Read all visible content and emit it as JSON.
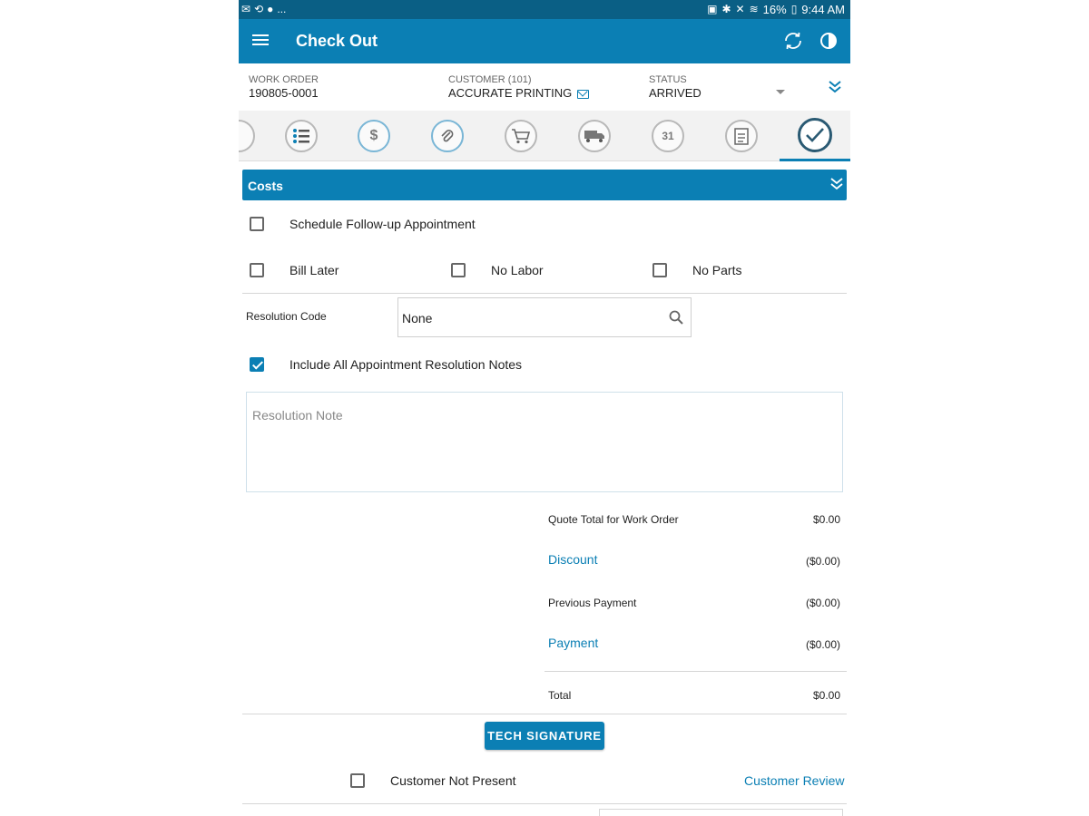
{
  "status_bar": {
    "overflow": "...",
    "battery": "16%",
    "time": "9:44 AM"
  },
  "app_bar": {
    "title": "Check Out"
  },
  "work_order_header": {
    "work_order_label": "WORK ORDER",
    "work_order_value": "190805-0001",
    "customer_label": "CUSTOMER (101)",
    "customer_value": "ACCURATE PRINTING",
    "status_label": "STATUS",
    "status_value": "ARRIVED"
  },
  "tabs": [
    {
      "icon": "partial-tab-icon"
    },
    {
      "icon": "list-icon"
    },
    {
      "icon": "dollar-quote-icon"
    },
    {
      "icon": "attachment-icon"
    },
    {
      "icon": "cart-icon"
    },
    {
      "icon": "truck-icon"
    },
    {
      "icon": "calendar-icon",
      "day": "31"
    },
    {
      "icon": "checklist-icon"
    },
    {
      "icon": "checkout-check-icon",
      "active": true
    }
  ],
  "costs_section": {
    "title": "Costs"
  },
  "options": {
    "schedule_follow_up": {
      "label": "Schedule Follow-up Appointment",
      "checked": false
    },
    "bill_later": {
      "label": "Bill Later",
      "checked": false
    },
    "no_labor": {
      "label": "No Labor",
      "checked": false
    },
    "no_parts": {
      "label": "No Parts",
      "checked": false
    },
    "include_notes": {
      "label": "Include All Appointment Resolution Notes",
      "checked": true
    }
  },
  "resolution": {
    "code_label": "Resolution Code",
    "code_value": "None",
    "note_placeholder": "Resolution Note"
  },
  "totals": {
    "quote_total_label": "Quote Total for Work Order",
    "quote_total_value": "$0.00",
    "discount_label": "Discount",
    "discount_value": "($0.00)",
    "previous_payment_label": "Previous Payment",
    "previous_payment_value": "($0.00)",
    "payment_label": "Payment",
    "payment_value": "($0.00)",
    "total_label": "Total",
    "total_value": "$0.00"
  },
  "signature": {
    "tech_signature_label": "TECH SIGNATURE",
    "customer_not_present_label": "Customer Not Present",
    "customer_not_present_checked": false,
    "customer_review_label": "Customer Review"
  },
  "colors": {
    "primary": "#0b7fb4",
    "status_bar": "#0a5f85",
    "active_tab_icon": "#2a5a73"
  }
}
